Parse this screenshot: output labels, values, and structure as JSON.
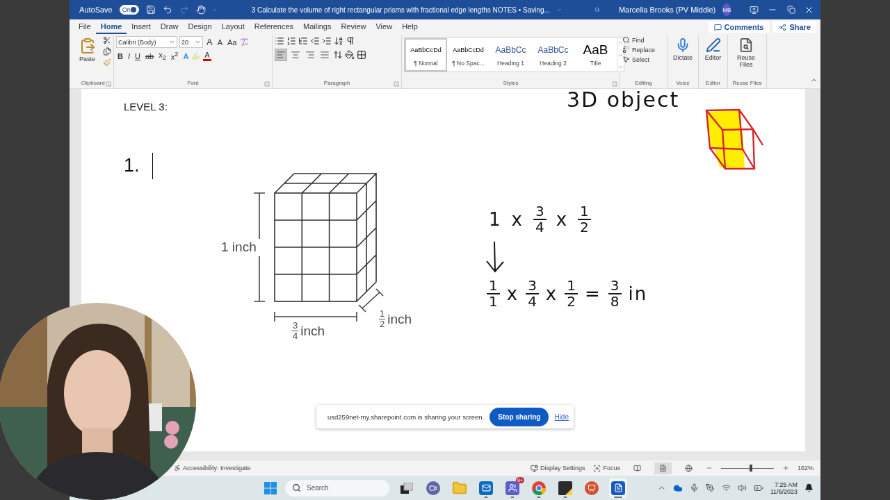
{
  "title_bar": {
    "autosave": {
      "label": "AutoSave",
      "toggle_text": "On",
      "on": true
    },
    "quick_access": [
      {
        "kind": "save",
        "disabled": false
      },
      {
        "kind": "undo",
        "disabled": false
      },
      {
        "kind": "redo",
        "disabled": true
      },
      {
        "kind": "touch",
        "disabled": false
      }
    ],
    "document_title": "3 Calculate the volume of right rectangular prisms with fractional edge lengths NOTES • Saving...",
    "user_name": "Marcella Brooks (PV Middle)",
    "avatar": "MB"
  },
  "tabs": [
    {
      "label": "File",
      "selected": false
    },
    {
      "label": "Home",
      "selected": true
    },
    {
      "label": "Insert",
      "selected": false
    },
    {
      "label": "Draw",
      "selected": false
    },
    {
      "label": "Design",
      "selected": false
    },
    {
      "label": "Layout",
      "selected": false
    },
    {
      "label": "References",
      "selected": false
    },
    {
      "label": "Mailings",
      "selected": false
    },
    {
      "label": "Review",
      "selected": false
    },
    {
      "label": "View",
      "selected": false
    },
    {
      "label": "Help",
      "selected": false
    }
  ],
  "actions": {
    "comments": "Comments",
    "share": "Share"
  },
  "ribbon": {
    "clipboard": {
      "paste": "Paste",
      "label": "Clipboard"
    },
    "font": {
      "font_name": "Calibri (Body)",
      "font_size": "20",
      "grow": "A",
      "shrink": "A",
      "change_case": "Aa",
      "bold": "B",
      "italic": "I",
      "underline": "U",
      "strikethrough": "ab",
      "subscript": "x$_{2}$",
      "superscript": "x$^{2}$",
      "text_effects": "A",
      "font_color": "A",
      "label": "Font"
    },
    "paragraph": {
      "alignments": [
        {
          "kind": "left",
          "selected": true
        },
        {
          "kind": "center",
          "selected": false
        },
        {
          "kind": "right",
          "selected": false
        },
        {
          "kind": "justify",
          "selected": false
        }
      ],
      "label": "Paragraph"
    },
    "styles": {
      "items": [
        {
          "kind": "normal",
          "preview": "AaBbCcDd",
          "name": "¶ Normal",
          "selected": true
        },
        {
          "kind": "nospacing",
          "preview": "AaBbCcDd",
          "name": "¶ No Spac...",
          "selected": false
        },
        {
          "kind": "heading1",
          "preview": "AaBbCc",
          "name": "Heading 1",
          "selected": false
        },
        {
          "kind": "heading2",
          "preview": "AaBbCc",
          "name": "Heading 2",
          "selected": false
        },
        {
          "kind": "title",
          "preview": "AaB",
          "name": "Title",
          "selected": false
        }
      ],
      "label": "Styles"
    },
    "editing": {
      "items": [
        {
          "kind": "find",
          "label": "Find"
        },
        {
          "kind": "replace",
          "label": "Replace"
        },
        {
          "kind": "select",
          "label": "Select"
        }
      ],
      "label": "Editing"
    },
    "voice": {
      "button": "Dictate",
      "label": "Voice"
    },
    "editor": {
      "button": "Editor",
      "label": "Editor"
    },
    "reuse": {
      "button": "Reuse Files",
      "label": "Reuse Files"
    }
  },
  "document": {
    "heading": "LEVEL 3:",
    "item_number": "1.",
    "ink": {
      "caption": "3D object",
      "line1": [
        {
          "kind": "text",
          "text": "1"
        },
        {
          "kind": "text",
          "text": "x"
        },
        {
          "kind": "frac",
          "num": "3",
          "den": "4"
        },
        {
          "kind": "text",
          "text": "x"
        },
        {
          "kind": "frac",
          "num": "1",
          "den": "2"
        }
      ],
      "line2": [
        {
          "kind": "frac",
          "num": "1",
          "den": "1"
        },
        {
          "kind": "text",
          "text": "x"
        },
        {
          "kind": "frac",
          "num": "3",
          "den": "4"
        },
        {
          "kind": "text",
          "text": "x"
        },
        {
          "kind": "frac",
          "num": "1",
          "den": "2"
        },
        {
          "kind": "text",
          "text": "="
        },
        {
          "kind": "frac",
          "num": "3",
          "den": "8"
        },
        {
          "kind": "text",
          "text": "in"
        }
      ]
    },
    "diagram": {
      "height_label": "1 inch",
      "width_label": {
        "num": "3",
        "den": "4",
        "unit": "inch"
      },
      "depth_label": {
        "num": "1",
        "den": "2",
        "unit": "inch"
      }
    }
  },
  "sharing": {
    "message": "usd259net-my.sharepoint.com is sharing your screen.",
    "stop": "Stop sharing",
    "hide": "Hide"
  },
  "status_bar": {
    "accessibility": "Accessibility: Investigate",
    "display_settings": "Display Settings",
    "focus": "Focus",
    "views": [
      {
        "kind": "read",
        "selected": false
      },
      {
        "kind": "print",
        "selected": true
      },
      {
        "kind": "web",
        "selected": false
      }
    ],
    "zoom": {
      "level": 0.57,
      "reading": "162%"
    }
  },
  "taskbar": {
    "search": "Search",
    "apps": [
      {
        "kind": "taskview",
        "running": false,
        "selected": false
      },
      {
        "kind": "chat",
        "running": false,
        "selected": false
      },
      {
        "kind": "folder",
        "running": false,
        "selected": false
      },
      {
        "kind": "mail",
        "running": true,
        "selected": false
      },
      {
        "kind": "team",
        "running": true,
        "selected": false,
        "badge": "9+"
      },
      {
        "kind": "browser",
        "running": true,
        "selected": false
      },
      {
        "kind": "notes",
        "running": true,
        "selected": false
      },
      {
        "kind": "slides",
        "running": false,
        "selected": false
      },
      {
        "kind": "word",
        "running": true,
        "selected": true
      }
    ],
    "time": "7:25 AM",
    "date": "11/6/2023"
  }
}
